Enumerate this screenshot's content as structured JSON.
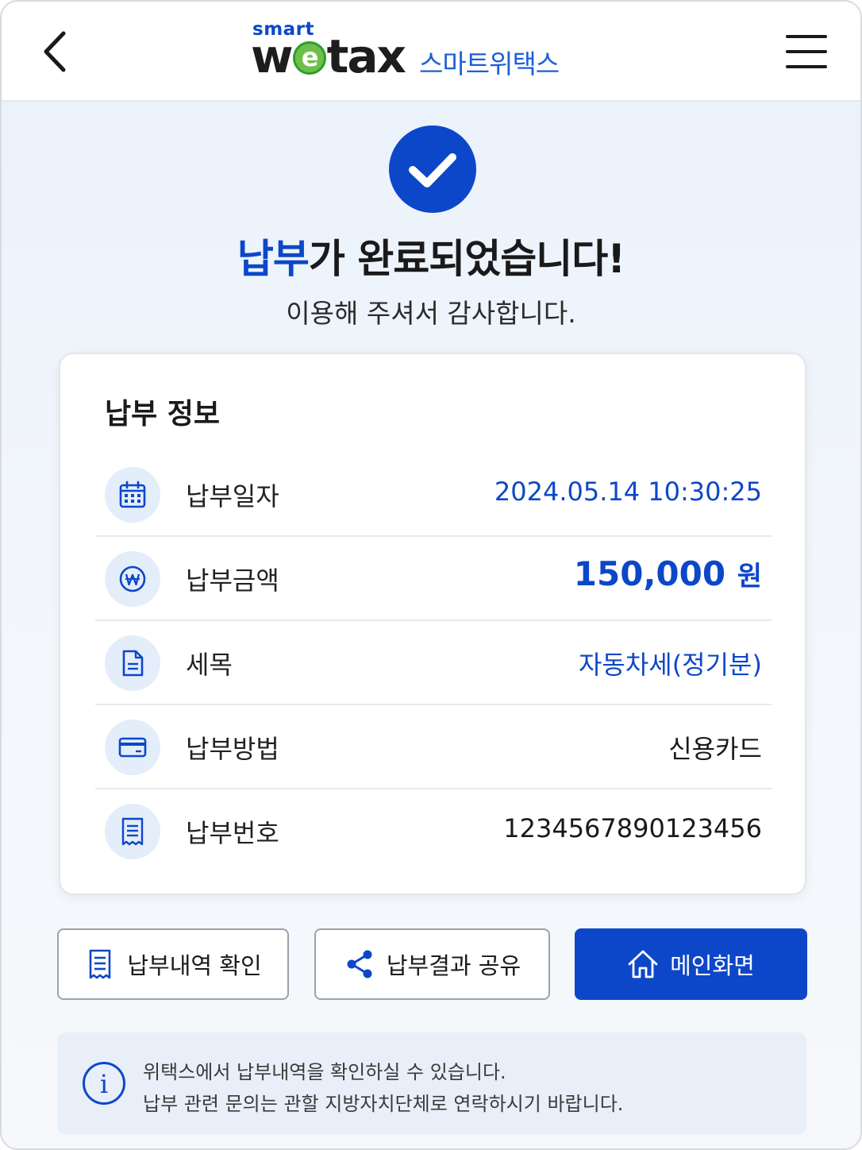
{
  "header": {
    "logo_small": "smart",
    "logo_w": "w",
    "logo_e": "e",
    "logo_rest": "tax",
    "logo_kr": "스마트위택스",
    "back_icon": "chevron-left-icon",
    "menu_icon": "hamburger-menu-icon"
  },
  "status": {
    "icon": "check-circle-icon",
    "title_accent": "납부",
    "title_rest": "가 완료되었습니다!",
    "subtitle": "이용해 주셔서 감사합니다."
  },
  "payment_info": {
    "title": "납부 정보",
    "rows": [
      {
        "icon": "calendar-icon",
        "label": "납부일자",
        "value": "2024.05.14 10:30:25"
      },
      {
        "icon": "won-coin-icon",
        "label": "납부금액",
        "value": "150,000",
        "unit": "원"
      },
      {
        "icon": "document-icon",
        "label": "세목",
        "value": "자동차세(정기분)"
      },
      {
        "icon": "credit-card-icon",
        "label": "납부방법",
        "value": "신용카드"
      },
      {
        "icon": "receipt-icon",
        "label": "납부번호",
        "value": "1234567890123456"
      }
    ]
  },
  "actions": {
    "history": {
      "label": "납부내역 확인",
      "icon": "receipt-icon"
    },
    "share": {
      "label": "납부결과 공유",
      "icon": "share-icon"
    },
    "home": {
      "label": "메인화면",
      "icon": "home-icon"
    }
  },
  "notice": {
    "icon": "info-icon",
    "line1": "위택스에서 납부내역을 확인하실 수 있습니다.",
    "line2": "납부 관련 문의는 관할 지방자치단체로 연락하시기 바랍니다."
  },
  "colors": {
    "primary": "#0d47c9",
    "accent_text": "#1d5fd6",
    "logo_green": "#6cc04a",
    "icon_bg": "#e4edfa"
  }
}
